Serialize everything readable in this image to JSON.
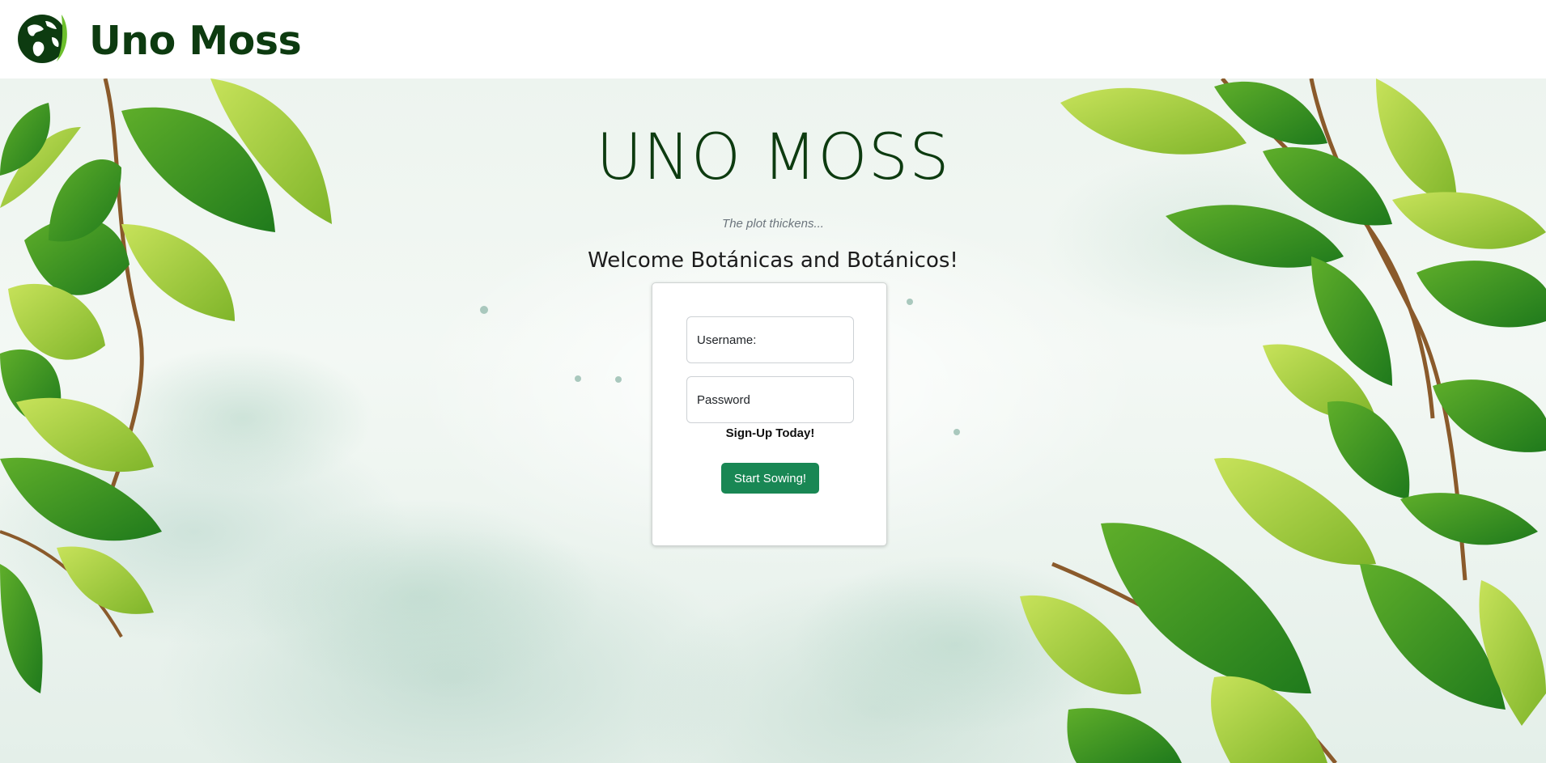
{
  "brand": {
    "name": "Uno Moss",
    "logo_icon": "globe-leaf-icon"
  },
  "hero": {
    "title": "UNO MOSS",
    "tagline": "The plot thickens...",
    "welcome": "Welcome Botánicas and Botánicos!"
  },
  "login": {
    "username_placeholder": "Username:",
    "password_placeholder": "Password",
    "signup_label": "Sign-Up Today!",
    "submit_label": "Start Sowing!"
  },
  "colors": {
    "brand_green": "#0d3b10",
    "button_green": "#198754",
    "leaf_dark": "#2f8a24",
    "leaf_light": "#9ccc2c"
  }
}
